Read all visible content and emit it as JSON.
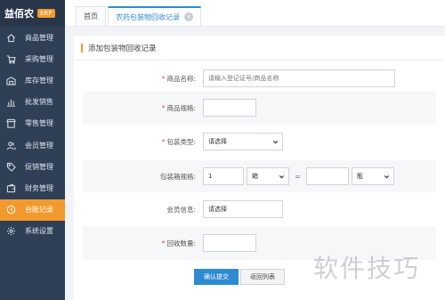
{
  "brand": {
    "name": "益佰农",
    "badge": "ERP"
  },
  "sidebar": {
    "items": [
      {
        "label": "商品管理",
        "icon": "home-icon"
      },
      {
        "label": "采购管理",
        "icon": "cart-icon"
      },
      {
        "label": "库存管理",
        "icon": "warehouse-icon"
      },
      {
        "label": "批发销售",
        "icon": "chart-icon"
      },
      {
        "label": "零售管理",
        "icon": "shop-icon"
      },
      {
        "label": "会员管理",
        "icon": "users-icon"
      },
      {
        "label": "促销管理",
        "icon": "tag-icon"
      },
      {
        "label": "财务管理",
        "icon": "wallet-icon"
      },
      {
        "label": "台账记录",
        "icon": "clock-icon",
        "active": true
      },
      {
        "label": "系统设置",
        "icon": "gear-icon"
      }
    ]
  },
  "tabs": [
    {
      "label": "首页"
    },
    {
      "label": "农药包装物回收记录",
      "active": true
    }
  ],
  "panel": {
    "title": "添加包装物回收记录"
  },
  "form": {
    "product_name": {
      "label": "商品名称:",
      "placeholder": "请输入登记证号/商品名称"
    },
    "spec": {
      "label": "商品规格:"
    },
    "package_type": {
      "label": "包装类型:",
      "value": "请选择"
    },
    "pack_spec": {
      "label": "包装箱规格:",
      "qty": "1",
      "unit1": "箱",
      "eq": "=",
      "unit2": "瓶"
    },
    "member": {
      "label": "会员信息:",
      "value": "请选择"
    },
    "recycle_qty": {
      "label": "回收数量:"
    },
    "submit_label": "确认提交",
    "back_label": "返回列表"
  },
  "watermark": "软件技巧",
  "colors": {
    "sidebar": "#2f3f55",
    "accent": "#f29a2e",
    "primary": "#2f8bd1",
    "required": "#e5533b"
  }
}
